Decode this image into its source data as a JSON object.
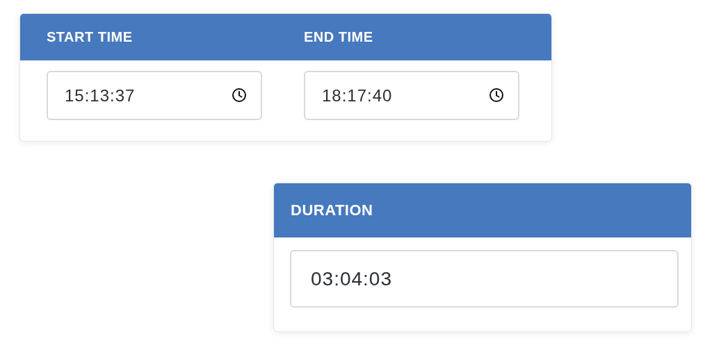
{
  "time_range": {
    "columns": [
      {
        "label": "START TIME",
        "value": "15:13:37"
      },
      {
        "label": "END TIME",
        "value": "18:17:40"
      }
    ]
  },
  "duration": {
    "label": "DURATION",
    "value": "03:04:03"
  }
}
